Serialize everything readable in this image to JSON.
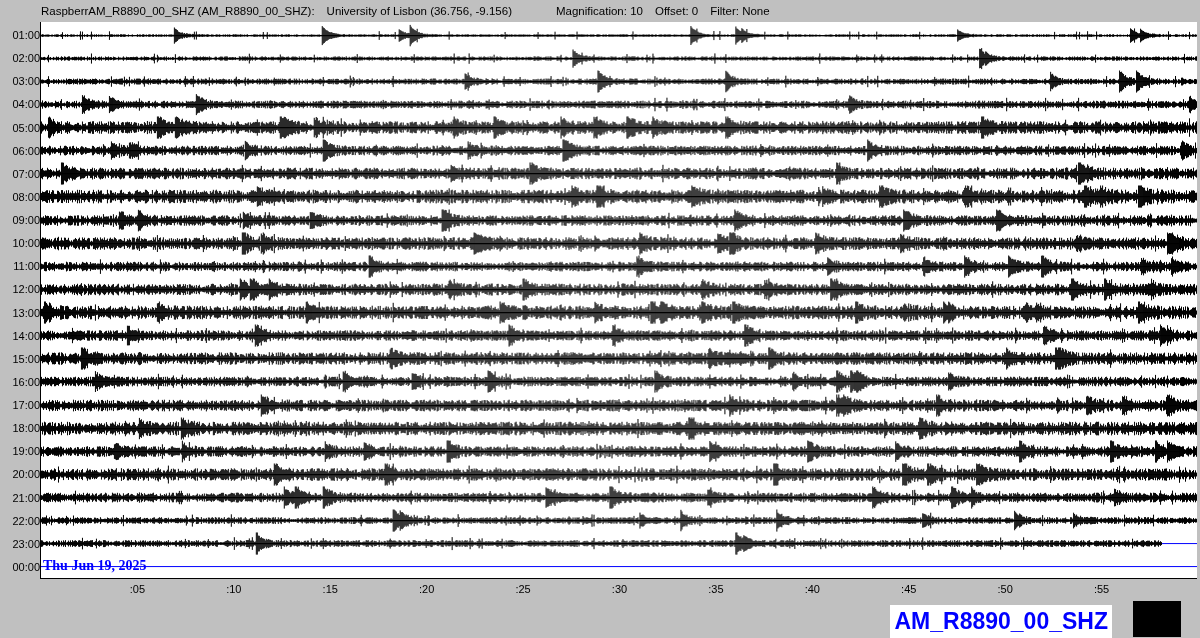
{
  "header": {
    "channel": "RaspberrAM_R8890_00_SHZ (AM_R8890_00_SHZ):",
    "location": "University of Lisbon (36.756, -9.156)",
    "magnification": "Magnification: 10",
    "offset": "Offset: 0",
    "filter": "Filter: None"
  },
  "rows": [
    {
      "label": "01:00",
      "level": 1
    },
    {
      "label": "02:00",
      "level": 1
    },
    {
      "label": "03:00",
      "level": 1
    },
    {
      "label": "04:00",
      "level": 1
    },
    {
      "label": "05:00",
      "level": 1
    },
    {
      "label": "06:00",
      "level": 1
    },
    {
      "label": "07:00",
      "level": 1
    },
    {
      "label": "08:00",
      "level": 1
    },
    {
      "label": "09:00",
      "level": 1
    },
    {
      "label": "10:00",
      "level": 1
    },
    {
      "label": "11:00",
      "level": 1
    },
    {
      "label": "12:00",
      "level": 1
    },
    {
      "label": "13:00",
      "level": 1
    },
    {
      "label": "14:00",
      "level": 1
    },
    {
      "label": "15:00",
      "level": 1
    },
    {
      "label": "16:00",
      "level": 1
    },
    {
      "label": "17:00",
      "level": 1
    },
    {
      "label": "18:00",
      "level": 1
    },
    {
      "label": "19:00",
      "level": 1
    },
    {
      "label": "20:00",
      "level": 1
    },
    {
      "label": "21:00",
      "level": 1
    },
    {
      "label": "22:00",
      "level": 1
    },
    {
      "label": "23:00",
      "level": 0.97
    },
    {
      "label": "00:00",
      "date": "Thu Jun 19, 2025"
    }
  ],
  "x_ticks": [
    ":05",
    ":10",
    ":15",
    ":20",
    ":25",
    ":30",
    ":35",
    ":40",
    ":45",
    ":50",
    ":55"
  ],
  "station_label": "AM_R8890_00_SHZ"
}
